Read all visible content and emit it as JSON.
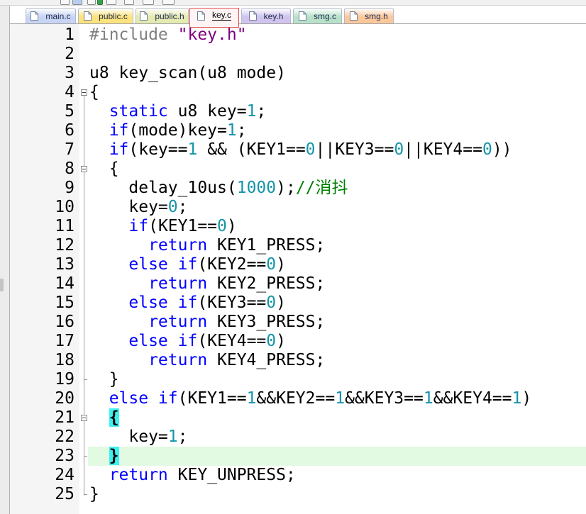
{
  "tabs": [
    {
      "label": "main.c",
      "icon": "file-icon",
      "color": "#c8d4f3",
      "active": false
    },
    {
      "label": "public.c",
      "icon": "file-icon",
      "color": "#fce37e",
      "active": false
    },
    {
      "label": "public.h",
      "icon": "file-icon",
      "color": "#e4eab2",
      "active": false
    },
    {
      "label": "key.c",
      "icon": "file-icon",
      "color": "#fff4f4",
      "active": true,
      "border_color": "#e14f4f"
    },
    {
      "label": "key.h",
      "icon": "file-icon",
      "color": "#d0c4ee",
      "active": false
    },
    {
      "label": "smg.c",
      "icon": "file-icon",
      "color": "#b9e1ca",
      "active": false
    },
    {
      "label": "smg.h",
      "icon": "file-icon",
      "color": "#fbc89c",
      "active": false
    }
  ],
  "editor": {
    "current_line": 23,
    "current_line_color": "#e2f9e2",
    "lines": [
      {
        "number": 1,
        "tokens": [
          {
            "text": "#include ",
            "color": "#808080"
          },
          {
            "text": "\"key.h\"",
            "color": "#800080"
          }
        ]
      },
      {
        "number": 2,
        "tokens": []
      },
      {
        "number": 3,
        "tokens": [
          {
            "text": "u8 key_scan(u8 mode)",
            "color": "#000000"
          }
        ]
      },
      {
        "number": 4,
        "tokens": [
          {
            "text": "{",
            "color": "#000000"
          }
        ]
      },
      {
        "number": 5,
        "tokens": [
          {
            "text": "  static",
            "color": "#0000ff"
          },
          {
            "text": " u8 key=",
            "color": "#000000"
          },
          {
            "text": "1",
            "color": "#1495a8"
          },
          {
            "text": ";",
            "color": "#000000"
          }
        ]
      },
      {
        "number": 6,
        "tokens": [
          {
            "text": "  if",
            "color": "#0000ff"
          },
          {
            "text": "(mode)key=",
            "color": "#000000"
          },
          {
            "text": "1",
            "color": "#1495a8"
          },
          {
            "text": ";",
            "color": "#000000"
          }
        ]
      },
      {
        "number": 7,
        "tokens": [
          {
            "text": "  if",
            "color": "#0000ff"
          },
          {
            "text": "(key==",
            "color": "#000000"
          },
          {
            "text": "1",
            "color": "#1495a8"
          },
          {
            "text": " && (KEY1==",
            "color": "#000000"
          },
          {
            "text": "0",
            "color": "#1495a8"
          },
          {
            "text": "||KEY3==",
            "color": "#000000"
          },
          {
            "text": "0",
            "color": "#1495a8"
          },
          {
            "text": "||KEY4==",
            "color": "#000000"
          },
          {
            "text": "0",
            "color": "#1495a8"
          },
          {
            "text": "))",
            "color": "#000000"
          }
        ]
      },
      {
        "number": 8,
        "tokens": [
          {
            "text": "  {",
            "color": "#000000"
          }
        ]
      },
      {
        "number": 9,
        "tokens": [
          {
            "text": "    delay_10us(",
            "color": "#000000"
          },
          {
            "text": "1000",
            "color": "#1495a8"
          },
          {
            "text": ");",
            "color": "#000000"
          },
          {
            "text": "//消抖",
            "color": "#008000"
          }
        ]
      },
      {
        "number": 10,
        "tokens": [
          {
            "text": "    key=",
            "color": "#000000"
          },
          {
            "text": "0",
            "color": "#1495a8"
          },
          {
            "text": ";",
            "color": "#000000"
          }
        ]
      },
      {
        "number": 11,
        "tokens": [
          {
            "text": "    if",
            "color": "#0000ff"
          },
          {
            "text": "(KEY1==",
            "color": "#000000"
          },
          {
            "text": "0",
            "color": "#1495a8"
          },
          {
            "text": ")",
            "color": "#000000"
          }
        ]
      },
      {
        "number": 12,
        "tokens": [
          {
            "text": "      return",
            "color": "#0000ff"
          },
          {
            "text": " KEY1_PRESS;",
            "color": "#000000"
          }
        ]
      },
      {
        "number": 13,
        "tokens": [
          {
            "text": "    else if",
            "color": "#0000ff"
          },
          {
            "text": "(KEY2==",
            "color": "#000000"
          },
          {
            "text": "0",
            "color": "#1495a8"
          },
          {
            "text": ")",
            "color": "#000000"
          }
        ]
      },
      {
        "number": 14,
        "tokens": [
          {
            "text": "      return",
            "color": "#0000ff"
          },
          {
            "text": " KEY2_PRESS;",
            "color": "#000000"
          }
        ]
      },
      {
        "number": 15,
        "tokens": [
          {
            "text": "    else if",
            "color": "#0000ff"
          },
          {
            "text": "(KEY3==",
            "color": "#000000"
          },
          {
            "text": "0",
            "color": "#1495a8"
          },
          {
            "text": ")",
            "color": "#000000"
          }
        ]
      },
      {
        "number": 16,
        "tokens": [
          {
            "text": "      return",
            "color": "#0000ff"
          },
          {
            "text": " KEY3_PRESS;",
            "color": "#000000"
          }
        ]
      },
      {
        "number": 17,
        "tokens": [
          {
            "text": "    else if",
            "color": "#0000ff"
          },
          {
            "text": "(KEY4==",
            "color": "#000000"
          },
          {
            "text": "0",
            "color": "#1495a8"
          },
          {
            "text": ")",
            "color": "#000000"
          }
        ]
      },
      {
        "number": 18,
        "tokens": [
          {
            "text": "      return",
            "color": "#0000ff"
          },
          {
            "text": " KEY4_PRESS;",
            "color": "#000000"
          }
        ]
      },
      {
        "number": 19,
        "tokens": [
          {
            "text": "  }",
            "color": "#000000"
          }
        ]
      },
      {
        "number": 20,
        "tokens": [
          {
            "text": "  else if",
            "color": "#0000ff"
          },
          {
            "text": "(KEY1==",
            "color": "#000000"
          },
          {
            "text": "1",
            "color": "#1495a8"
          },
          {
            "text": "&&KEY2==",
            "color": "#000000"
          },
          {
            "text": "1",
            "color": "#1495a8"
          },
          {
            "text": "&&KEY3==",
            "color": "#000000"
          },
          {
            "text": "1",
            "color": "#1495a8"
          },
          {
            "text": "&&KEY4==",
            "color": "#000000"
          },
          {
            "text": "1",
            "color": "#1495a8"
          },
          {
            "text": ")",
            "color": "#000000"
          }
        ]
      },
      {
        "number": 21,
        "tokens": [
          {
            "text": "  ",
            "color": "#000000"
          },
          {
            "text": "{",
            "color": "#000000",
            "highlight": "#3cf0f0",
            "bold": true
          }
        ]
      },
      {
        "number": 22,
        "tokens": [
          {
            "text": "    key=",
            "color": "#000000"
          },
          {
            "text": "1",
            "color": "#1495a8"
          },
          {
            "text": ";",
            "color": "#000000"
          }
        ]
      },
      {
        "number": 23,
        "tokens": [
          {
            "text": "  ",
            "color": "#000000"
          },
          {
            "text": "}",
            "color": "#000000",
            "highlight": "#3cf0f0",
            "bold": true
          }
        ]
      },
      {
        "number": 24,
        "tokens": [
          {
            "text": "  return",
            "color": "#0000ff"
          },
          {
            "text": " KEY_UNPRESS;",
            "color": "#000000"
          }
        ]
      },
      {
        "number": 25,
        "tokens": [
          {
            "text": "}",
            "color": "#000000"
          }
        ]
      }
    ]
  }
}
